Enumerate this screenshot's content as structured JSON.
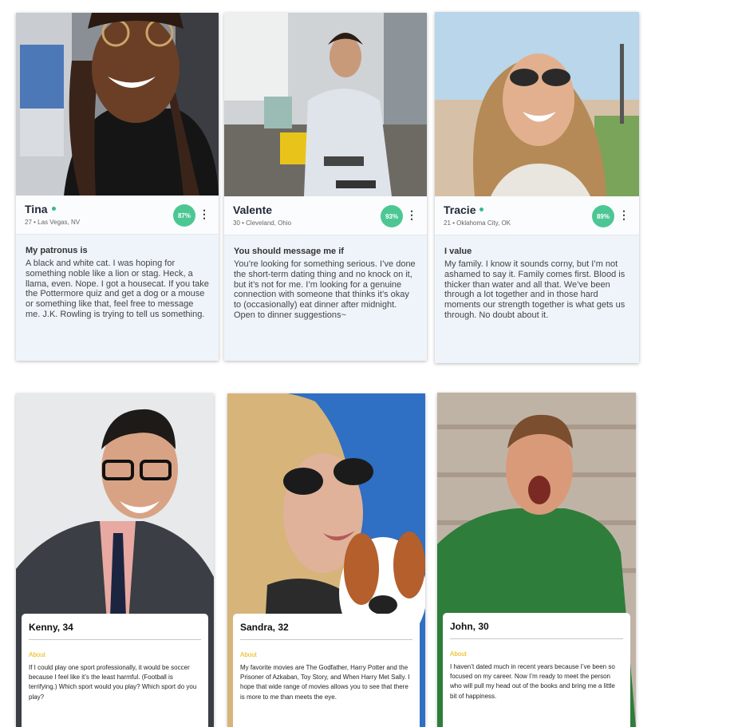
{
  "top_cards": [
    {
      "name": "Tina",
      "meta": "27 • Las Vegas, NV",
      "match": "87%",
      "prompt": "My patronus is",
      "answer": "A black and white cat. I was hoping for something noble like a lion or stag. Heck, a llama, even. Nope. I got a housecat. If you take the Pottermore quiz and get a dog or a mouse or something like that, feel free to message me. J.K. Rowling is trying to tell us something."
    },
    {
      "name": "Valente",
      "meta": "30 • Cleveland, Ohio",
      "match": "93%",
      "prompt": "You should message me if",
      "answer": "You’re looking for something serious. I’ve done the short-term dating thing and no knock on it, but it’s not for me. I’m looking for a genuine connection with someone that thinks it’s okay to (occasionally) eat dinner after midnight. Open to dinner suggestions~"
    },
    {
      "name": "Tracie",
      "meta": "21 • Oklahoma City, OK",
      "match": "89%",
      "prompt": "I value",
      "answer": "My family. I know it sounds corny, but I’m not ashamed to say it. Family comes first. Blood is thicker than water and all that. We’ve been through a lot together and in those hard moments our strength together is what gets us through. No doubt about it."
    }
  ],
  "bottom_cards": [
    {
      "name": "Kenny, 34",
      "about_label": "About",
      "about": "If I could play one sport professionally, it would be soccer because I feel like it’s the least harmful. (Football is terrifying.) Which sport would you play? Which sport do you play?"
    },
    {
      "name": "Sandra, 32",
      "about_label": "About",
      "about": "My favorite movies are The Godfather, Harry Potter and the Prisoner of Azkaban, Toy Story, and When Harry Met Sally. I hope that wide range of movies allows you to see that there is more to me than meets the eye."
    },
    {
      "name": "John, 30",
      "about_label": "About",
      "about": "I haven’t dated much in recent years because I’ve been so focused on my career. Now I’m ready to meet the person who will pull my head out of the books and bring me a little bit of happiness."
    }
  ],
  "icons": {
    "menu": "more-vertical-icon",
    "online": "online-dot-icon"
  },
  "colors": {
    "match_badge": "#4cc794",
    "online_dot": "#39b98a",
    "about_label": "#e8b400",
    "card_body_bg": "#eff4fa"
  }
}
